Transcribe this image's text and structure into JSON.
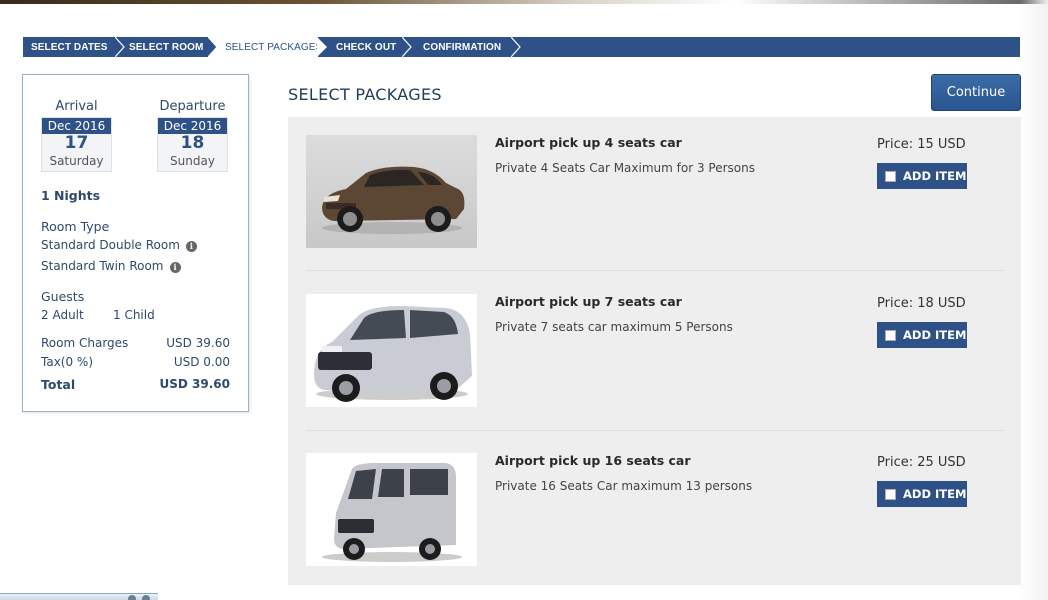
{
  "steps": [
    {
      "label": "SELECT DATES",
      "active": false
    },
    {
      "label": "SELECT ROOM",
      "active": false
    },
    {
      "label": "SELECT PACKAGES",
      "active": true
    },
    {
      "label": "CHECK OUT",
      "active": false
    },
    {
      "label": "CONFIRMATION",
      "active": false
    }
  ],
  "sidebar": {
    "arrival": {
      "title": "Arrival",
      "month": "Dec 2016",
      "day": "17",
      "weekday": "Saturday"
    },
    "departure": {
      "title": "Departure",
      "month": "Dec 2016",
      "day": "18",
      "weekday": "Sunday"
    },
    "nights": "1 Nights",
    "room_type_heading": "Room Type",
    "rooms": [
      "Standard Double Room",
      "Standard Twin Room"
    ],
    "guests_heading": "Guests",
    "adults": "2 Adult",
    "children": "1 Child",
    "room_charges_label": "Room Charges",
    "room_charges_value": "USD 39.60",
    "tax_label": "Tax(0 %)",
    "tax_value": "USD 0.00",
    "total_label": "Total",
    "total_value": "USD 39.60"
  },
  "main": {
    "title": "SELECT PACKAGES",
    "continue_label": "Continue",
    "packages": [
      {
        "name": "Airport pick up 4 seats car",
        "description": "Private 4 Seats Car Maximum for 3 Persons",
        "price": "Price: 15 USD",
        "button": "ADD ITEM",
        "image": "sedan-car-image"
      },
      {
        "name": "Airport pick up 7 seats car",
        "description": "Private 7 seats car maximum 5 Persons",
        "price": "Price: 18 USD",
        "button": "ADD ITEM",
        "image": "minivan-image"
      },
      {
        "name": "Airport pick up 16 seats car",
        "description": "Private 16 Seats Car maximum 13 persons",
        "price": "Price: 25 USD",
        "button": "ADD ITEM",
        "image": "van-image"
      }
    ]
  },
  "colors": {
    "primary": "#2e5187",
    "panel": "#eeeeee",
    "text": "#2e4a6b"
  }
}
